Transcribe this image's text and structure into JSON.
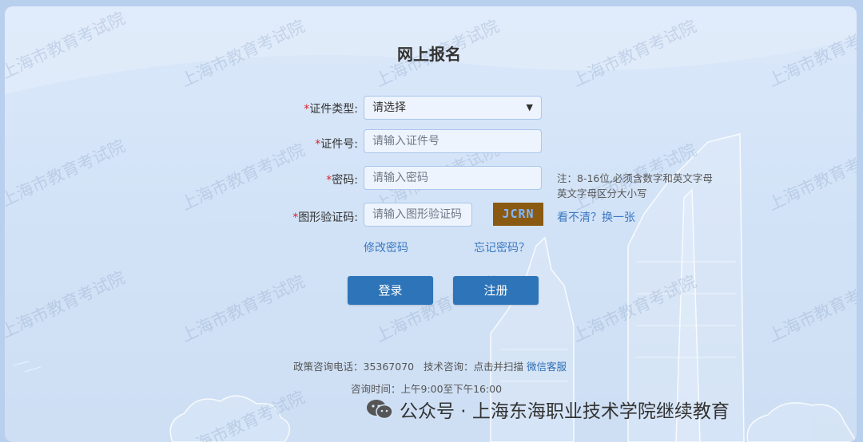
{
  "title": "网上报名",
  "form": {
    "id_type": {
      "required_mark": "*",
      "label": "证件类型:",
      "value": "请选择"
    },
    "id_number": {
      "required_mark": "*",
      "label": "证件号:",
      "placeholder": "请输入证件号"
    },
    "password": {
      "required_mark": "*",
      "label": "密码:",
      "placeholder": "请输入密码",
      "hint_line1": "注：8-16位,必须含数字和英文字母",
      "hint_line2": "英文字母区分大小写"
    },
    "captcha": {
      "required_mark": "*",
      "label": "图形验证码:",
      "placeholder": "请输入图形验证码",
      "image_text": "JCRN",
      "refresh_link": "看不清？换一张"
    }
  },
  "links": {
    "change_password": "修改密码",
    "forgot_password": "忘记密码？"
  },
  "buttons": {
    "login": "登录",
    "register": "注册"
  },
  "footer": {
    "policy_label": "政策咨询电话：35367070",
    "tech_label": "技术咨询：点击并扫描",
    "wechat_link": "微信客服",
    "hours": "咨询时间：上午9:00至下午16:00"
  },
  "watermark_text": "上海市教育考试院",
  "wechat_account": "公众号 · 上海东海职业技术学院继续教育",
  "colors": {
    "required": "#d9232e",
    "button": "#2e74b8",
    "link": "#3a78c2",
    "captcha_bg": "#8a5a12"
  }
}
